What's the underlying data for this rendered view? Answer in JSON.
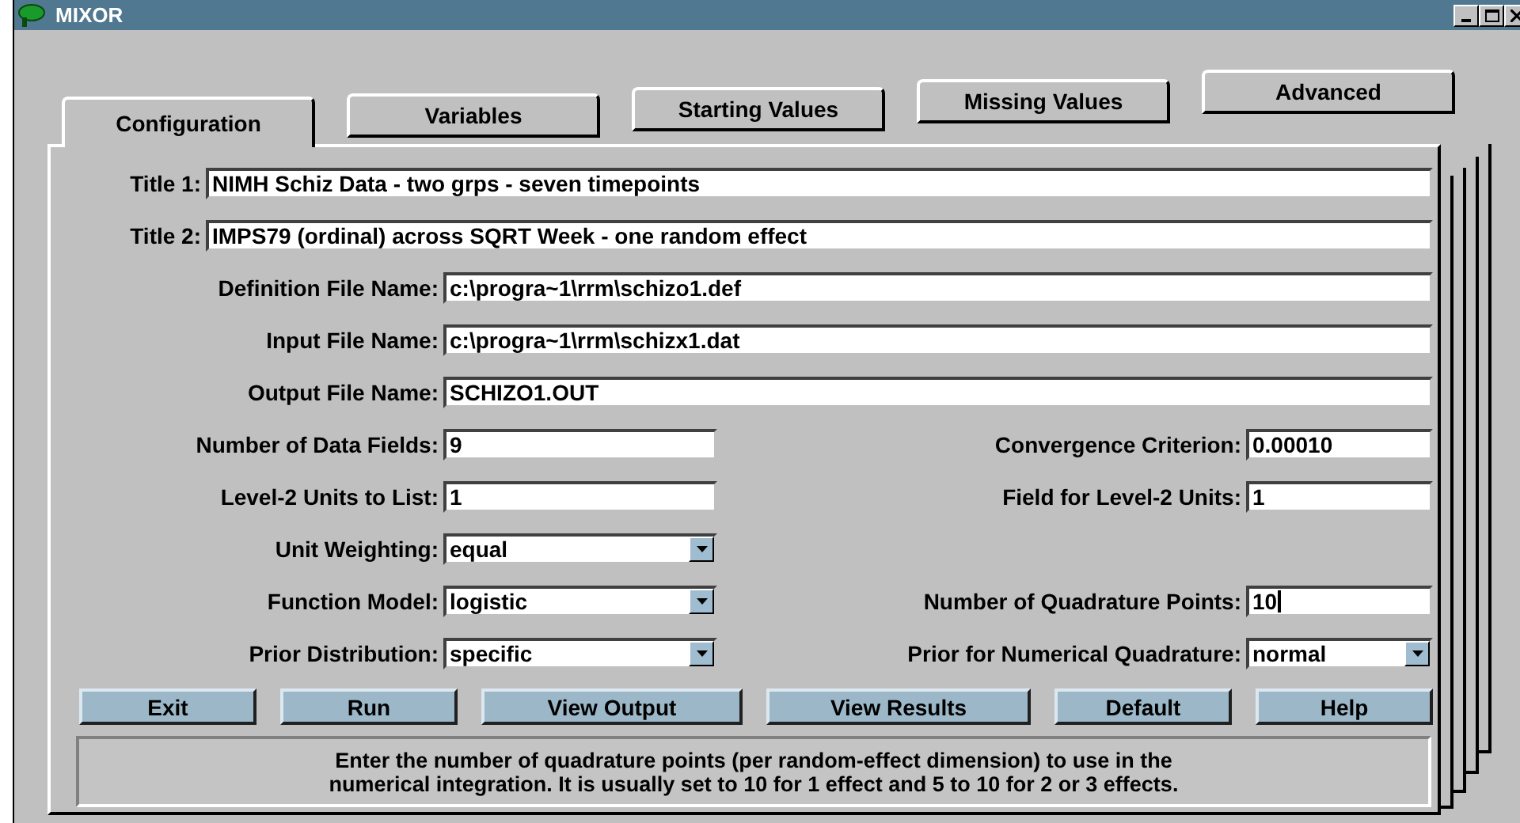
{
  "window": {
    "title": "MIXOR"
  },
  "tabs": [
    {
      "label": "Configuration",
      "selected": true
    },
    {
      "label": "Variables",
      "selected": false
    },
    {
      "label": "Starting Values",
      "selected": false
    },
    {
      "label": "Missing Values",
      "selected": false
    },
    {
      "label": "Advanced",
      "selected": false
    }
  ],
  "title_fields": [
    {
      "label": "Title 1:",
      "value": "NIMH Schiz Data - two grps - seven timepoints"
    },
    {
      "label": "Title 2:",
      "value": "IMPS79 (ordinal) across SQRT Week - one random effect"
    }
  ],
  "file_fields": [
    {
      "label": "Definition File Name:",
      "value": "c:\\progra~1\\rrm\\schizo1.def"
    },
    {
      "label": "Input File Name:",
      "value": "c:\\progra~1\\rrm\\schizx1.dat"
    },
    {
      "label": "Output File Name:",
      "value": "SCHIZO1.OUT"
    }
  ],
  "form_rows": [
    {
      "left": {
        "kind": "text",
        "label": "Number of Data Fields:",
        "value": "9",
        "focused": false
      },
      "right": {
        "kind": "text",
        "label": "Convergence Criterion:",
        "value": "0.00010",
        "focused": false
      }
    },
    {
      "left": {
        "kind": "text",
        "label": "Level-2 Units to List:",
        "value": "1",
        "focused": false
      },
      "right": {
        "kind": "text",
        "label": "Field for Level-2 Units:",
        "value": "1",
        "focused": false
      }
    },
    {
      "left": {
        "kind": "dropdown",
        "label": "Unit Weighting:",
        "value": "equal"
      }
    },
    {
      "left": {
        "kind": "dropdown",
        "label": "Function Model:",
        "value": "logistic"
      },
      "right": {
        "kind": "text",
        "label": "Number of Quadrature Points:",
        "value": "10",
        "focused": true
      }
    },
    {
      "left": {
        "kind": "dropdown",
        "label": "Prior Distribution:",
        "value": "specific"
      },
      "right": {
        "kind": "dropdown",
        "label": "Prior for Numerical Quadrature:",
        "value": "normal"
      }
    }
  ],
  "buttons": [
    {
      "label": "Exit"
    },
    {
      "label": "Run"
    },
    {
      "label": "View Output"
    },
    {
      "label": "View Results"
    },
    {
      "label": "Default"
    },
    {
      "label": "Help"
    }
  ],
  "help_text": "Enter the number of quadrature points (per random-effect dimension) to use in the\nnumerical integration.  It is usually set to 10 for 1 effect and 5 to 10 for 2 or 3 effects."
}
